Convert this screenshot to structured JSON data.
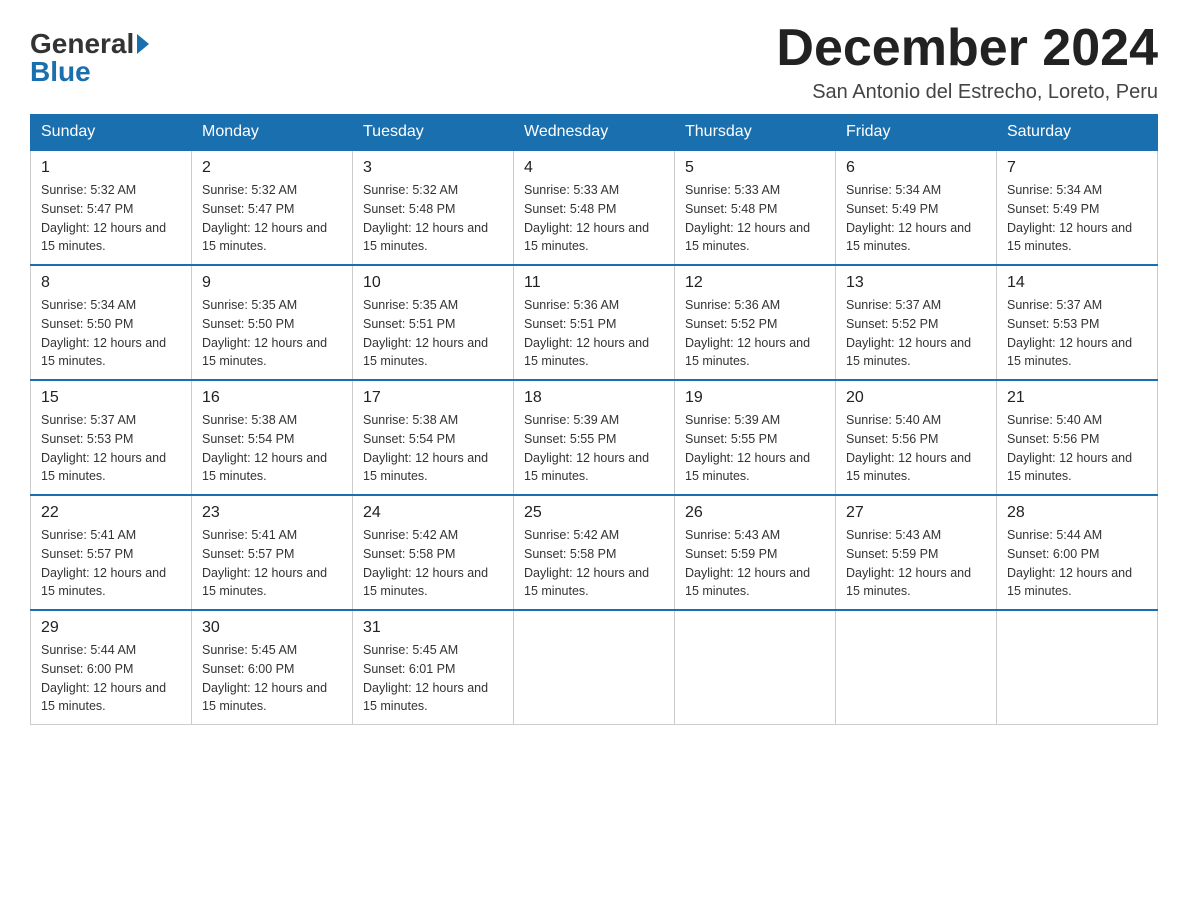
{
  "logo": {
    "general": "General",
    "blue": "Blue"
  },
  "title": "December 2024",
  "location": "San Antonio del Estrecho, Loreto, Peru",
  "days_of_week": [
    "Sunday",
    "Monday",
    "Tuesday",
    "Wednesday",
    "Thursday",
    "Friday",
    "Saturday"
  ],
  "weeks": [
    [
      {
        "day": "1",
        "sunrise": "5:32 AM",
        "sunset": "5:47 PM",
        "daylight": "12 hours and 15 minutes."
      },
      {
        "day": "2",
        "sunrise": "5:32 AM",
        "sunset": "5:47 PM",
        "daylight": "12 hours and 15 minutes."
      },
      {
        "day": "3",
        "sunrise": "5:32 AM",
        "sunset": "5:48 PM",
        "daylight": "12 hours and 15 minutes."
      },
      {
        "day": "4",
        "sunrise": "5:33 AM",
        "sunset": "5:48 PM",
        "daylight": "12 hours and 15 minutes."
      },
      {
        "day": "5",
        "sunrise": "5:33 AM",
        "sunset": "5:48 PM",
        "daylight": "12 hours and 15 minutes."
      },
      {
        "day": "6",
        "sunrise": "5:34 AM",
        "sunset": "5:49 PM",
        "daylight": "12 hours and 15 minutes."
      },
      {
        "day": "7",
        "sunrise": "5:34 AM",
        "sunset": "5:49 PM",
        "daylight": "12 hours and 15 minutes."
      }
    ],
    [
      {
        "day": "8",
        "sunrise": "5:34 AM",
        "sunset": "5:50 PM",
        "daylight": "12 hours and 15 minutes."
      },
      {
        "day": "9",
        "sunrise": "5:35 AM",
        "sunset": "5:50 PM",
        "daylight": "12 hours and 15 minutes."
      },
      {
        "day": "10",
        "sunrise": "5:35 AM",
        "sunset": "5:51 PM",
        "daylight": "12 hours and 15 minutes."
      },
      {
        "day": "11",
        "sunrise": "5:36 AM",
        "sunset": "5:51 PM",
        "daylight": "12 hours and 15 minutes."
      },
      {
        "day": "12",
        "sunrise": "5:36 AM",
        "sunset": "5:52 PM",
        "daylight": "12 hours and 15 minutes."
      },
      {
        "day": "13",
        "sunrise": "5:37 AM",
        "sunset": "5:52 PM",
        "daylight": "12 hours and 15 minutes."
      },
      {
        "day": "14",
        "sunrise": "5:37 AM",
        "sunset": "5:53 PM",
        "daylight": "12 hours and 15 minutes."
      }
    ],
    [
      {
        "day": "15",
        "sunrise": "5:37 AM",
        "sunset": "5:53 PM",
        "daylight": "12 hours and 15 minutes."
      },
      {
        "day": "16",
        "sunrise": "5:38 AM",
        "sunset": "5:54 PM",
        "daylight": "12 hours and 15 minutes."
      },
      {
        "day": "17",
        "sunrise": "5:38 AM",
        "sunset": "5:54 PM",
        "daylight": "12 hours and 15 minutes."
      },
      {
        "day": "18",
        "sunrise": "5:39 AM",
        "sunset": "5:55 PM",
        "daylight": "12 hours and 15 minutes."
      },
      {
        "day": "19",
        "sunrise": "5:39 AM",
        "sunset": "5:55 PM",
        "daylight": "12 hours and 15 minutes."
      },
      {
        "day": "20",
        "sunrise": "5:40 AM",
        "sunset": "5:56 PM",
        "daylight": "12 hours and 15 minutes."
      },
      {
        "day": "21",
        "sunrise": "5:40 AM",
        "sunset": "5:56 PM",
        "daylight": "12 hours and 15 minutes."
      }
    ],
    [
      {
        "day": "22",
        "sunrise": "5:41 AM",
        "sunset": "5:57 PM",
        "daylight": "12 hours and 15 minutes."
      },
      {
        "day": "23",
        "sunrise": "5:41 AM",
        "sunset": "5:57 PM",
        "daylight": "12 hours and 15 minutes."
      },
      {
        "day": "24",
        "sunrise": "5:42 AM",
        "sunset": "5:58 PM",
        "daylight": "12 hours and 15 minutes."
      },
      {
        "day": "25",
        "sunrise": "5:42 AM",
        "sunset": "5:58 PM",
        "daylight": "12 hours and 15 minutes."
      },
      {
        "day": "26",
        "sunrise": "5:43 AM",
        "sunset": "5:59 PM",
        "daylight": "12 hours and 15 minutes."
      },
      {
        "day": "27",
        "sunrise": "5:43 AM",
        "sunset": "5:59 PM",
        "daylight": "12 hours and 15 minutes."
      },
      {
        "day": "28",
        "sunrise": "5:44 AM",
        "sunset": "6:00 PM",
        "daylight": "12 hours and 15 minutes."
      }
    ],
    [
      {
        "day": "29",
        "sunrise": "5:44 AM",
        "sunset": "6:00 PM",
        "daylight": "12 hours and 15 minutes."
      },
      {
        "day": "30",
        "sunrise": "5:45 AM",
        "sunset": "6:00 PM",
        "daylight": "12 hours and 15 minutes."
      },
      {
        "day": "31",
        "sunrise": "5:45 AM",
        "sunset": "6:01 PM",
        "daylight": "12 hours and 15 minutes."
      },
      null,
      null,
      null,
      null
    ]
  ]
}
